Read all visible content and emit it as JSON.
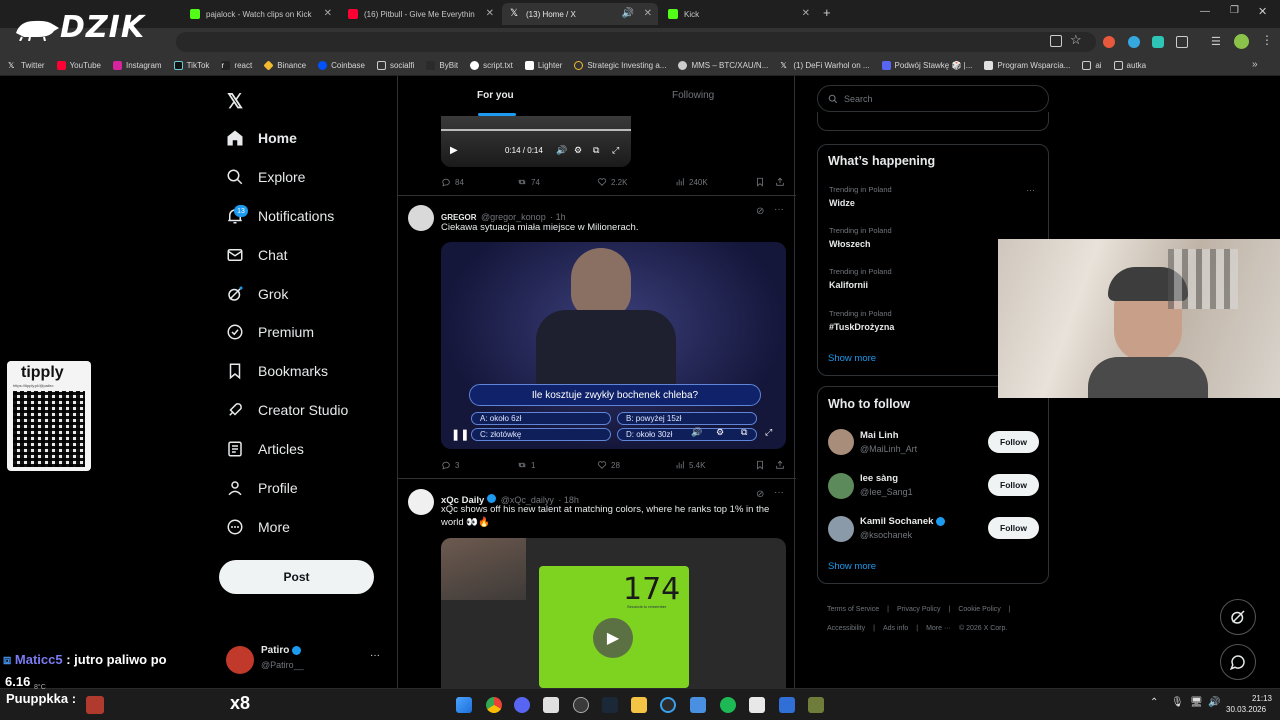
{
  "browser": {
    "tabs": [
      {
        "title": "pajalock - Watch clips on Kick",
        "favicon_color": "#53fc18"
      },
      {
        "title": "(16) Pitbull - Give Me Everythin",
        "favicon_color": "#ff0033"
      },
      {
        "title": "(13) Home / X",
        "favicon_color": "#ffffff"
      },
      {
        "title": "Kick",
        "favicon_color": "#53fc18"
      }
    ],
    "new_tab": "+",
    "bookmarks": [
      "Twitter",
      "YouTube",
      "Instagram",
      "TikTok",
      "react",
      "Binance",
      "Coinbase",
      "socialfi",
      "ByBit",
      "script.txt",
      "Lighter",
      "Strategic Investing a...",
      "MMS – BTC/XAU/N...",
      "(1) DeFi Warhol on ...",
      "Podwój Stawkę 🎲 |...",
      "Program Wsparcia...",
      "ai",
      "autka"
    ],
    "more_bookmarks": "»"
  },
  "overlay": {
    "logo_text": "DZIK",
    "tipply_title": "tipply",
    "tipply_url": "https://tipply.pl/@patiro",
    "chat_user": "Maticc5",
    "chat_message": ": jutro paliwo po",
    "chat_message_2": "6.16",
    "chat_user_2": "Puuppkka",
    "chat_sep": ":",
    "temp": "8°C"
  },
  "sidebar": {
    "items": [
      {
        "label": "Home",
        "icon": "home-icon"
      },
      {
        "label": "Explore",
        "icon": "search-icon"
      },
      {
        "label": "Notifications",
        "icon": "bell-icon"
      },
      {
        "label": "Chat",
        "icon": "mail-icon"
      },
      {
        "label": "Grok",
        "icon": "grok-icon"
      },
      {
        "label": "Premium",
        "icon": "premium-icon"
      },
      {
        "label": "Bookmarks",
        "icon": "bookmark-icon"
      },
      {
        "label": "Creator Studio",
        "icon": "rocket-icon"
      },
      {
        "label": "Articles",
        "icon": "articles-icon"
      },
      {
        "label": "Profile",
        "icon": "person-icon"
      },
      {
        "label": "More",
        "icon": "more-circle-icon"
      }
    ],
    "notifications_count": "13",
    "post_label": "Post",
    "account_name": "Patiro",
    "account_handle": "@Patiro__",
    "account_more": "···"
  },
  "feed": {
    "tabs": [
      "For you",
      "Following"
    ],
    "video1": {
      "time": "0:14 / 0:14"
    },
    "actions1": {
      "replies": "84",
      "reposts": "74",
      "likes": "2.2K",
      "views": "240K"
    },
    "tweet2": {
      "name": "GREGOR",
      "handle": "@gregor_konop",
      "time": "· 1h",
      "text": "Ciekawa sytuacja miała miejsce w Milionerach.",
      "question": "Ile kosztuje zwykły bochenek chleba?",
      "answers": [
        "A: około 6zł",
        "B: powyżej 15zł",
        "C: złotówkę",
        "D: około 30zł"
      ],
      "replies": "3",
      "reposts": "1",
      "likes": "28",
      "views": "5.4K"
    },
    "tweet3": {
      "name": "xQc Daily",
      "handle": "@xQc_dailyy",
      "time": "· 18h",
      "text": "xQc shows off his new talent at matching colors, where he ranks top 1% in the world 👀🔥",
      "game_score": "174",
      "game_caption": "Seconds to remember"
    }
  },
  "right": {
    "search_placeholder": "Search",
    "whats_happening_title": "What’s happening",
    "trends": [
      {
        "category": "Trending in Poland",
        "name": "Widze"
      },
      {
        "category": "Trending in Poland",
        "name": "Włoszech"
      },
      {
        "category": "Trending in Poland",
        "name": "Kalifornii"
      },
      {
        "category": "Trending in Poland",
        "name": "#TuskDrożyzna"
      }
    ],
    "trend_more": "···",
    "show_more": "Show more",
    "who_to_follow_title": "Who to follow",
    "follow": [
      {
        "name": "Mai Linh",
        "handle": "@MaiLinh_Art",
        "button": "Follow",
        "verified": false
      },
      {
        "name": "Iee sàng",
        "handle": "@Iee_Sang1",
        "button": "Follow",
        "verified": false
      },
      {
        "name": "Kamil Sochanek",
        "handle": "@ksochanek",
        "button": "Follow",
        "verified": true
      }
    ],
    "who_show_more": "Show more",
    "footer": [
      "Terms of Service",
      "|",
      "Privacy Policy",
      "|",
      "Cookie Policy",
      "|",
      "Accessibility",
      "|",
      "Ads info",
      "|",
      "More ···",
      "© 2026 X Corp."
    ]
  },
  "taskbar": {
    "time": "21:13",
    "date": "30.03.2026"
  },
  "colors": {
    "accent": "#1d9bf0",
    "background": "#000000",
    "border": "#2f3336",
    "muted": "#71767b"
  }
}
